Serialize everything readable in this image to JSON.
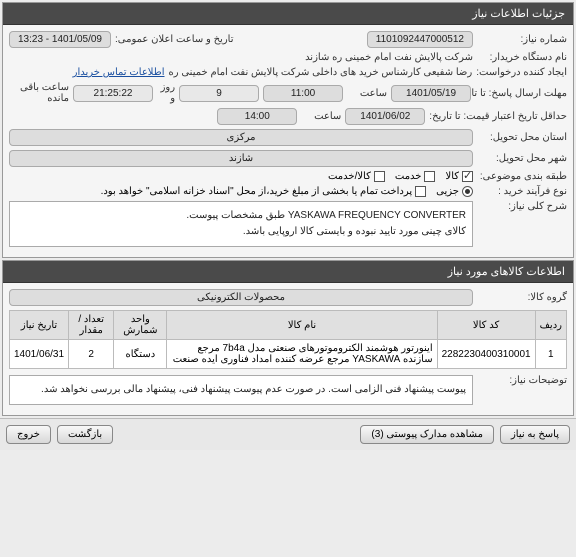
{
  "panel_details": {
    "title": "جزئیات اطلاعات نیاز",
    "need_number_label": "شماره نیاز:",
    "need_number": "1101092447000512",
    "announce_datetime_label": "تاریخ و ساعت اعلان عمومی:",
    "announce_datetime": "1401/05/09 - 13:23",
    "buyer_org_label": "نام دستگاه خریدار:",
    "buyer_org": "شرکت پالایش نفت امام خمینی  ره  شازند",
    "requester_label": "ایجاد کننده درخواست:",
    "requester": "رضا  شفیعی  کارشناس خرید های داخلی  شرکت پالایش نفت امام خمینی  ره",
    "contact_link": "اطلاعات تماس خریدار",
    "deadline_label": "مهلت ارسال پاسخ:  تا تاریخ:",
    "deadline_date": "1401/05/19",
    "time_label": "ساعت",
    "deadline_time": "11:00",
    "days_left_prefix": "",
    "days_left_value": "9",
    "days_left_mid": "روز و",
    "time_remaining": "21:25:22",
    "time_remaining_suffix": "ساعت باقی مانده",
    "price_validity_label": "حداقل تاریخ اعتبار قیمت:  تا تاریخ:",
    "price_validity_date": "1401/06/02",
    "price_validity_time": "14:00",
    "province_label": "استان محل تحویل:",
    "province": "مرکزی",
    "city_label": "شهر محل تحویل:",
    "city": "شازند",
    "category_label": "طبقه بندی موضوعی:",
    "cat_goods": "کالا",
    "cat_service": "خدمت",
    "cat_goods_service": "کالا/خدمت",
    "process_label": "نوع فرآیند خرید :",
    "process_partial": "جزیی",
    "process_note": "پرداخت تمام یا بخشی از مبلغ خرید،از محل \"اسناد خزانه اسلامی\" خواهد بود.",
    "need_desc_label": "شرح کلی نیاز:",
    "need_desc": "YASKAWA FREQUENCY CONVERTER طبق مشخصات پیوست.\nکالای چینی مورد تایید نبوده و بایستی کالا اروپایی باشد."
  },
  "panel_items": {
    "title": "اطلاعات کالاهای مورد نیاز",
    "group_label": "گروه کالا:",
    "group_value": "محصولات الکترونیکی",
    "columns": {
      "row": "ردیف",
      "code": "کد کالا",
      "name": "نام کالا",
      "unit": "واحد شمارش",
      "qty": "تعداد / مقدار",
      "date": "تاریخ نیاز"
    },
    "rows": [
      {
        "idx": "1",
        "code": "2282230400310001",
        "name": "اینورتور هوشمند الکتروموتورهای صنعتی مدل 7b4a مرجع سازنده YASKAWA مرجع عرضه کننده امداد فناوری ایده صنعت",
        "unit": "دستگاه",
        "qty": "2",
        "date": "1401/06/31"
      }
    ],
    "notes_label": "توضیحات نیاز:",
    "notes": "پیوست پیشنهاد فنی الزامی است. در صورت عدم پیوست پیشنهاد فنی، پیشنهاد مالی بررسی نخواهد شد."
  },
  "footer": {
    "reply": "پاسخ به نیاز",
    "attachments": "مشاهده مدارک پیوستی (3)",
    "back": "بازگشت",
    "exit": "خروج"
  }
}
